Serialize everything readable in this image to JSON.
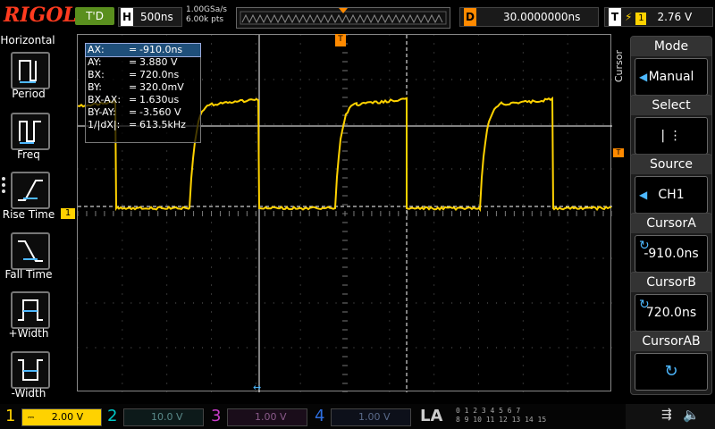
{
  "top": {
    "brand": "RIGOL",
    "trigger_status": "T'D",
    "h_key": "H",
    "h_value": "500ns",
    "sample_rate": "1.00GSa/s",
    "memory_depth": "6.00k pts",
    "d_key": "D",
    "d_value": "30.0000000ns",
    "t_key": "T",
    "t_source": "1",
    "t_level": "2.76 V"
  },
  "left_panel": {
    "title": "Horizontal",
    "items": [
      {
        "label": "Period",
        "icon": "period-icon"
      },
      {
        "label": "Freq",
        "icon": "freq-icon"
      },
      {
        "label": "Rise Time",
        "icon": "rise-time-icon"
      },
      {
        "label": "Fall Time",
        "icon": "fall-time-icon"
      },
      {
        "label": "+Width",
        "icon": "pos-width-icon"
      },
      {
        "label": "-Width",
        "icon": "neg-width-icon"
      }
    ]
  },
  "cursor_table": [
    {
      "name": "AX:",
      "value": "-910.0ns"
    },
    {
      "name": "AY:",
      "value": "3.880 V"
    },
    {
      "name": "BX:",
      "value": "720.0ns"
    },
    {
      "name": "BY:",
      "value": "320.0mV"
    },
    {
      "name": "BX-AX:",
      "value": "1.630us"
    },
    {
      "name": "BY-AY:",
      "value": "-3.560 V"
    },
    {
      "name": "1/|dX|:",
      "value": "613.5kHz"
    }
  ],
  "right_panel": {
    "side_label": "Cursor",
    "mode": {
      "title": "Mode",
      "value": "Manual"
    },
    "select": {
      "title": "Select",
      "value": "| ⋮"
    },
    "source": {
      "title": "Source",
      "value": "CH1"
    },
    "cursor_a": {
      "title": "CursorA",
      "value": "-910.0ns"
    },
    "cursor_b": {
      "title": "CursorB",
      "value": "720.0ns"
    },
    "cursor_ab": {
      "title": "CursorAB",
      "value": ""
    }
  },
  "markers": {
    "ch1": "1",
    "trigger_level": "T"
  },
  "channels": [
    {
      "num": "1",
      "scale": "2.00 V",
      "color": "#ffd200",
      "active": true
    },
    {
      "num": "2",
      "scale": "10.0 V",
      "color": "#00c8c8",
      "active": false
    },
    {
      "num": "3",
      "scale": "1.00 V",
      "color": "#c83cc8",
      "active": false
    },
    {
      "num": "4",
      "scale": "1.00 V",
      "color": "#2e6fe0",
      "active": false
    }
  ],
  "la": {
    "label": "LA",
    "row1": "0 1 2 3  4 5 6 7",
    "row2": "8 9 10 11 12 13 14 15"
  },
  "colors": {
    "ch1": "#ffd200",
    "accent": "#4db8ff",
    "orange": "#ff8a00"
  }
}
